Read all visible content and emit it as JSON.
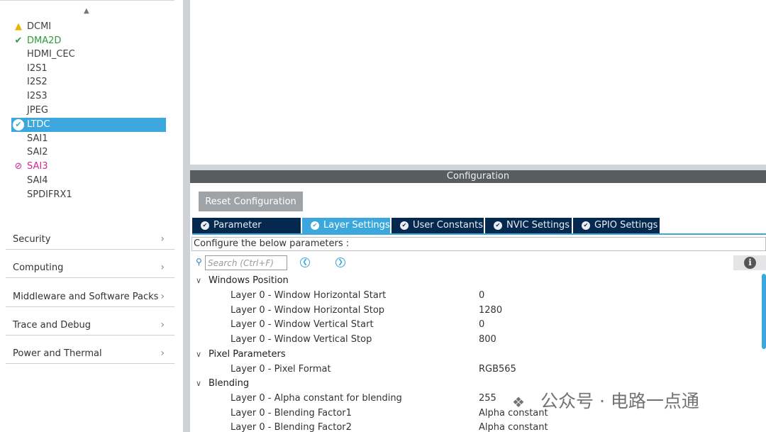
{
  "sidebar": {
    "peripherals": [
      {
        "label": "DCMI",
        "status": "warning",
        "icon": "warning-triangle-icon"
      },
      {
        "label": "DMA2D",
        "status": "ok",
        "icon": "checkmark-icon"
      },
      {
        "label": "HDMI_CEC",
        "status": "none",
        "icon": ""
      },
      {
        "label": "I2S1",
        "status": "none",
        "icon": ""
      },
      {
        "label": "I2S2",
        "status": "none",
        "icon": ""
      },
      {
        "label": "I2S3",
        "status": "none",
        "icon": ""
      },
      {
        "label": "JPEG",
        "status": "none",
        "icon": ""
      },
      {
        "label": "LTDC",
        "status": "selected-ok",
        "icon": "check-circle-icon"
      },
      {
        "label": "SAI1",
        "status": "none",
        "icon": ""
      },
      {
        "label": "SAI2",
        "status": "none",
        "icon": ""
      },
      {
        "label": "SAI3",
        "status": "disabled",
        "icon": "prohibited-icon"
      },
      {
        "label": "SAI4",
        "status": "none",
        "icon": ""
      },
      {
        "label": "SPDIFRX1",
        "status": "none",
        "icon": ""
      }
    ],
    "categories": [
      {
        "label": "Security"
      },
      {
        "label": "Computing"
      },
      {
        "label": "Middleware and Software Packs"
      },
      {
        "label": "Trace and Debug"
      },
      {
        "label": "Power and Thermal"
      }
    ]
  },
  "config": {
    "header": "Configuration",
    "reset_label": "Reset Configuration",
    "tabs": [
      {
        "label": "Parameter Settings",
        "active": false
      },
      {
        "label": "Layer Settings",
        "active": true
      },
      {
        "label": "User Constants",
        "active": false
      },
      {
        "label": "NVIC Settings",
        "active": false
      },
      {
        "label": "GPIO Settings",
        "active": false
      }
    ],
    "description": "Configure the below parameters :",
    "search_placeholder": "Search (Ctrl+F)",
    "groups": [
      {
        "title": "Windows Position",
        "params": [
          {
            "name": "Layer 0 - Window Horizontal Start",
            "value": "0"
          },
          {
            "name": "Layer 0 - Window Horizontal Stop",
            "value": "1280"
          },
          {
            "name": "Layer 0 - Window Vertical Start",
            "value": "0"
          },
          {
            "name": "Layer 0 - Window Vertical Stop",
            "value": "800"
          }
        ]
      },
      {
        "title": "Pixel Parameters",
        "params": [
          {
            "name": "Layer 0 - Pixel Format",
            "value": "RGB565"
          }
        ]
      },
      {
        "title": "Blending",
        "params": [
          {
            "name": "Layer 0 - Alpha constant for blending",
            "value": "255"
          },
          {
            "name": "Layer 0 - Blending Factor1",
            "value": "Alpha constant"
          },
          {
            "name": "Layer 0 - Blending Factor2",
            "value": "Alpha constant"
          }
        ]
      }
    ]
  },
  "watermark": {
    "text": "公众号 · 电路一点通"
  },
  "colors": {
    "accent": "#3ba7dc",
    "tab_dark": "#05284f",
    "header_bar": "#585d60",
    "warning": "#e8b400",
    "ok": "#2e9b3a",
    "disabled": "#cc2a8c"
  }
}
